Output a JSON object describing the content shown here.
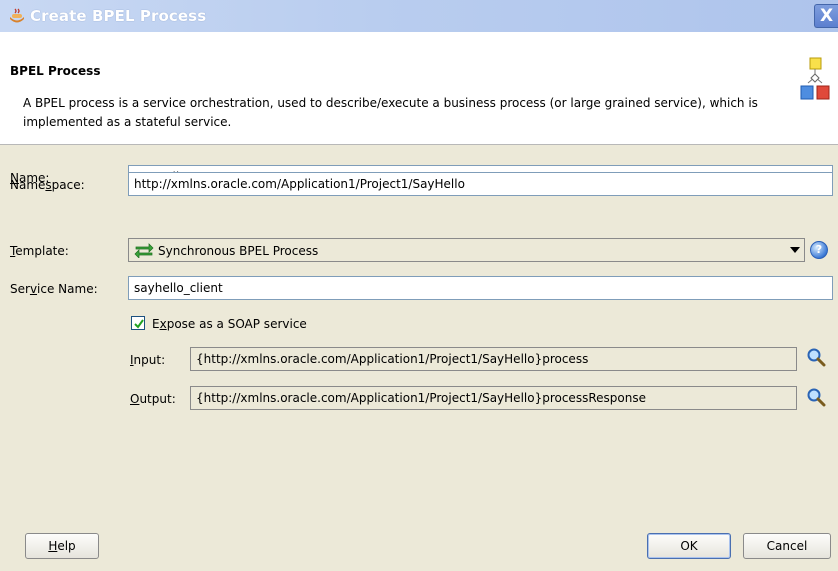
{
  "window": {
    "title": "Create BPEL Process",
    "close_glyph": "X"
  },
  "header": {
    "heading": "BPEL Process",
    "description": "A BPEL process is a service orchestration, used to describe/execute a business process (or large grained service), which is implemented as a stateful service.",
    "icon": "bpel-process-diagram-icon"
  },
  "form": {
    "name": {
      "label_pre": "",
      "label_mnemonic": "N",
      "label_post": "ame:",
      "value": "SayHello"
    },
    "namespace": {
      "label_pre": "Name",
      "label_mnemonic": "s",
      "label_post": "pace:",
      "value": "http://xmlns.oracle.com/Application1/Project1/SayHello"
    },
    "template": {
      "label_pre": "",
      "label_mnemonic": "T",
      "label_post": "emplate:",
      "value": "Synchronous BPEL Process",
      "icon": "sync-arrows-icon"
    },
    "service_name": {
      "label_pre": "Ser",
      "label_mnemonic": "v",
      "label_post": "ice Name:",
      "value": "sayhello_client"
    },
    "expose_soap": {
      "checked": true,
      "label_pre": "E",
      "label_mnemonic": "x",
      "label_post": "pose as a SOAP service"
    },
    "input": {
      "label_pre": "",
      "label_mnemonic": "I",
      "label_post": "nput:",
      "value": "{http://xmlns.oracle.com/Application1/Project1/SayHello}process"
    },
    "output": {
      "label_pre": "",
      "label_mnemonic": "O",
      "label_post": "utput:",
      "value": "{http://xmlns.oracle.com/Application1/Project1/SayHello}processResponse"
    }
  },
  "buttons": {
    "help": {
      "label_pre": "",
      "label_mnemonic": "H",
      "label_post": "elp"
    },
    "ok": "OK",
    "cancel": "Cancel"
  },
  "colors": {
    "titlebar": "#b9cdef",
    "dialog_bg": "#ece9d8",
    "field_border": "#7f9db9"
  }
}
